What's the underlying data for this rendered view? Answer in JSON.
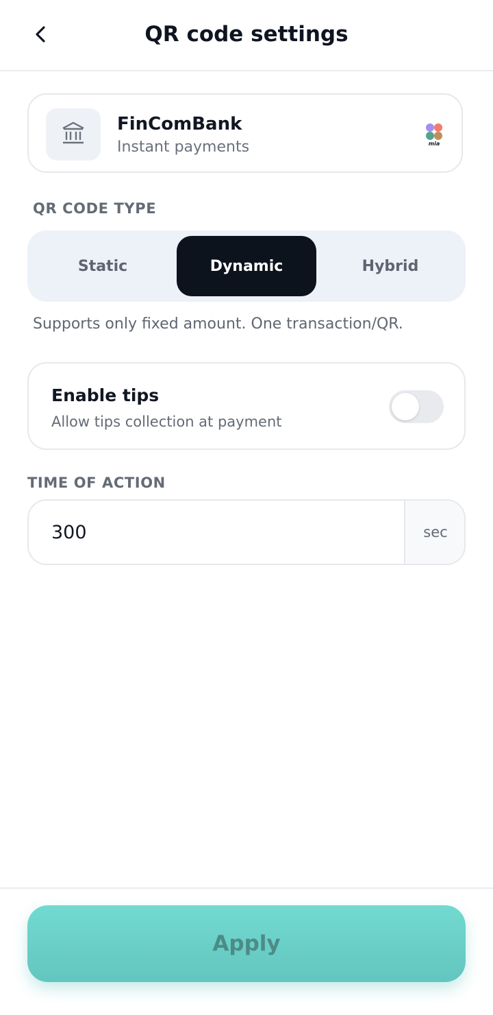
{
  "header": {
    "title": "QR code settings",
    "back_icon": "chevron-left-icon"
  },
  "bank": {
    "name": "FinComBank",
    "subtitle": "Instant payments",
    "icon": "bank-building-icon",
    "logo_text": "mia"
  },
  "qr_type": {
    "label": "QR CODE TYPE",
    "options": [
      "Static",
      "Dynamic",
      "Hybrid"
    ],
    "selected": "Dynamic",
    "helper": "Supports only fixed amount. One transaction/QR."
  },
  "tips": {
    "title": "Enable tips",
    "subtitle": "Allow tips collection at payment",
    "enabled": false
  },
  "time_of_action": {
    "label": "TIME OF ACTION",
    "value": "300",
    "unit": "sec"
  },
  "footer": {
    "apply_label": "Apply"
  },
  "colors": {
    "accent": "#6BD3CC",
    "selected_segment": "#0D131C",
    "segment_bg": "#EDF1F8"
  }
}
